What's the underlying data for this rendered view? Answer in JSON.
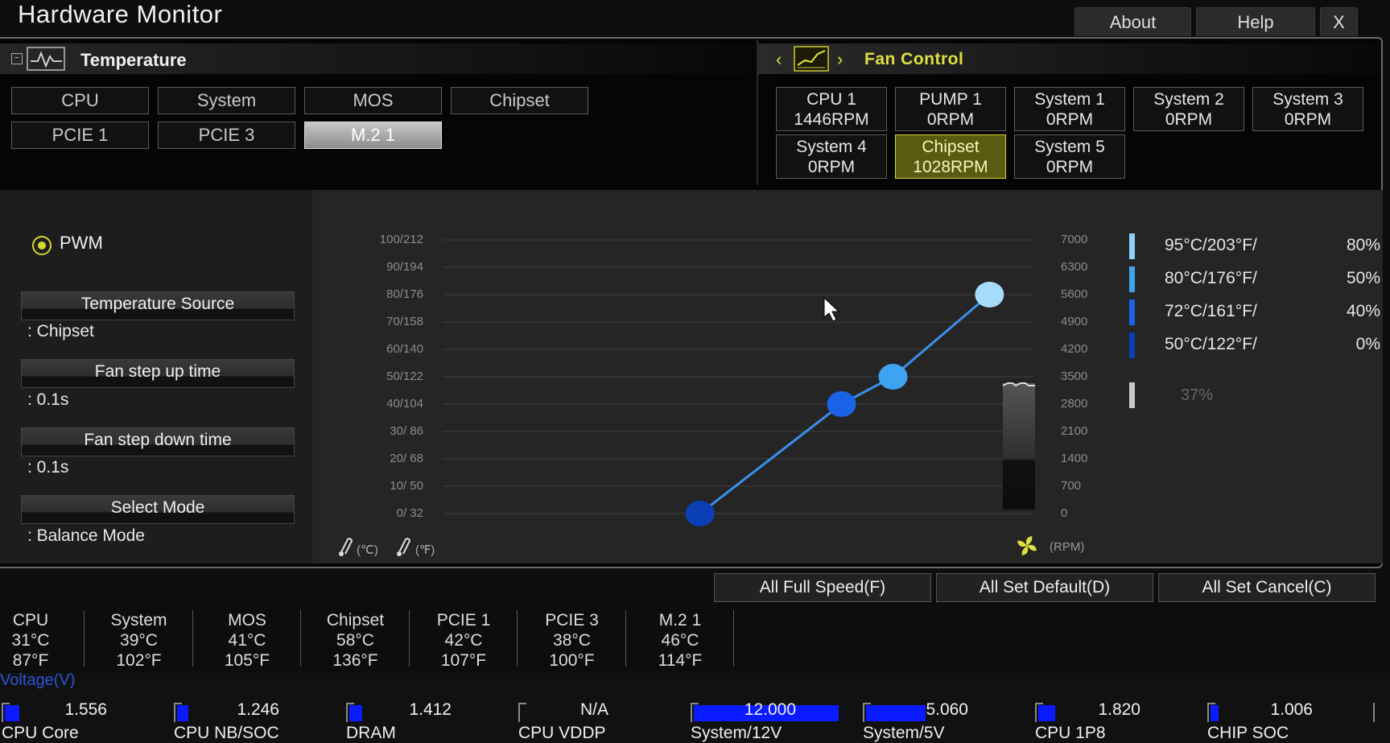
{
  "app": {
    "title": "Hardware Monitor"
  },
  "top_buttons": {
    "about": "About",
    "help": "Help",
    "close": "X"
  },
  "temperature": {
    "header": "Temperature",
    "sources": [
      "CPU",
      "System",
      "MOS",
      "Chipset",
      "PCIE 1",
      "PCIE 3",
      "M.2 1"
    ],
    "selected": "M.2 1"
  },
  "fan_control": {
    "header": "Fan Control",
    "fans": [
      {
        "name": "CPU 1",
        "rpm": "1446RPM"
      },
      {
        "name": "PUMP 1",
        "rpm": "0RPM"
      },
      {
        "name": "System 1",
        "rpm": "0RPM"
      },
      {
        "name": "System 2",
        "rpm": "0RPM"
      },
      {
        "name": "System 3",
        "rpm": "0RPM"
      },
      {
        "name": "System 4",
        "rpm": "0RPM"
      },
      {
        "name": "Chipset",
        "rpm": "1028RPM"
      },
      {
        "name": "System 5",
        "rpm": "0RPM"
      }
    ],
    "selected": "Chipset"
  },
  "settings": {
    "mode_radio": "PWM",
    "temp_source_label": "Temperature Source",
    "temp_source_value": ": Chipset",
    "step_up_label": "Fan step up time",
    "step_up_value": ": 0.1s",
    "step_down_label": "Fan step down time",
    "step_down_value": ": 0.1s",
    "select_mode_label": "Select Mode",
    "select_mode_value": ": Balance Mode"
  },
  "chart_data": {
    "type": "line",
    "left_ticks": [
      "100/212",
      "90/194",
      "80/176",
      "70/158",
      "60/140",
      "50/122",
      "40/104",
      "30/ 86",
      "20/ 68",
      "10/ 50",
      "0/ 32"
    ],
    "right_ticks": [
      "7000",
      "6300",
      "5600",
      "4900",
      "4200",
      "3500",
      "2800",
      "2100",
      "1400",
      "700",
      "0"
    ],
    "x_label_c": "(℃)",
    "x_label_f": "(℉)",
    "rpm_label": "(RPM)",
    "x_unit": "°C",
    "y_unit": "%",
    "x_range": [
      0,
      100
    ],
    "y_range": [
      0,
      100
    ],
    "grid": true,
    "points": [
      {
        "x": 50,
        "y": 0,
        "color": "#0a3fb5"
      },
      {
        "x": 72,
        "y": 40,
        "color": "#1a63e6"
      },
      {
        "x": 80,
        "y": 50,
        "color": "#3ea3f0"
      },
      {
        "x": 95,
        "y": 80,
        "color": "#a6dcfb"
      }
    ],
    "current_percent": 37,
    "legend": [
      {
        "temp": "95°C/203°F/",
        "pct": "80%",
        "color": "#8fd0f8"
      },
      {
        "temp": "80°C/176°F/",
        "pct": "50%",
        "color": "#3ea3f0"
      },
      {
        "temp": "72°C/161°F/",
        "pct": "40%",
        "color": "#1a63e6"
      },
      {
        "temp": "50°C/122°F/",
        "pct": "0%",
        "color": "#0a3fb5"
      }
    ],
    "current_label": "37%"
  },
  "actions": {
    "full_speed": "All Full Speed(F)",
    "set_default": "All Set Default(D)",
    "set_cancel": "All Set Cancel(C)"
  },
  "temps": [
    {
      "name": "CPU",
      "c": "31°C",
      "f": "87°F"
    },
    {
      "name": "System",
      "c": "39°C",
      "f": "102°F"
    },
    {
      "name": "MOS",
      "c": "41°C",
      "f": "105°F"
    },
    {
      "name": "Chipset",
      "c": "58°C",
      "f": "136°F"
    },
    {
      "name": "PCIE 1",
      "c": "42°C",
      "f": "107°F"
    },
    {
      "name": "PCIE 3",
      "c": "38°C",
      "f": "100°F"
    },
    {
      "name": "M.2 1",
      "c": "46°C",
      "f": "114°F"
    }
  ],
  "voltage": {
    "header": "Voltage(V)",
    "rails": [
      {
        "value": "1.556",
        "label": "CPU Core",
        "level": 0.09
      },
      {
        "value": "1.246",
        "label": "CPU NB/SOC",
        "level": 0.07
      },
      {
        "value": "1.412",
        "label": "DRAM",
        "level": 0.08
      },
      {
        "value": "N/A",
        "label": "CPU VDDP",
        "level": 0
      },
      {
        "value": "12.000",
        "label": "System/12V",
        "level": 0.88
      },
      {
        "value": "5.060",
        "label": "System/5V",
        "level": 0.36
      },
      {
        "value": "1.820",
        "label": "CPU 1P8",
        "level": 0.1
      },
      {
        "value": "1.006",
        "label": "CHIP SOC",
        "level": 0.05
      }
    ]
  }
}
